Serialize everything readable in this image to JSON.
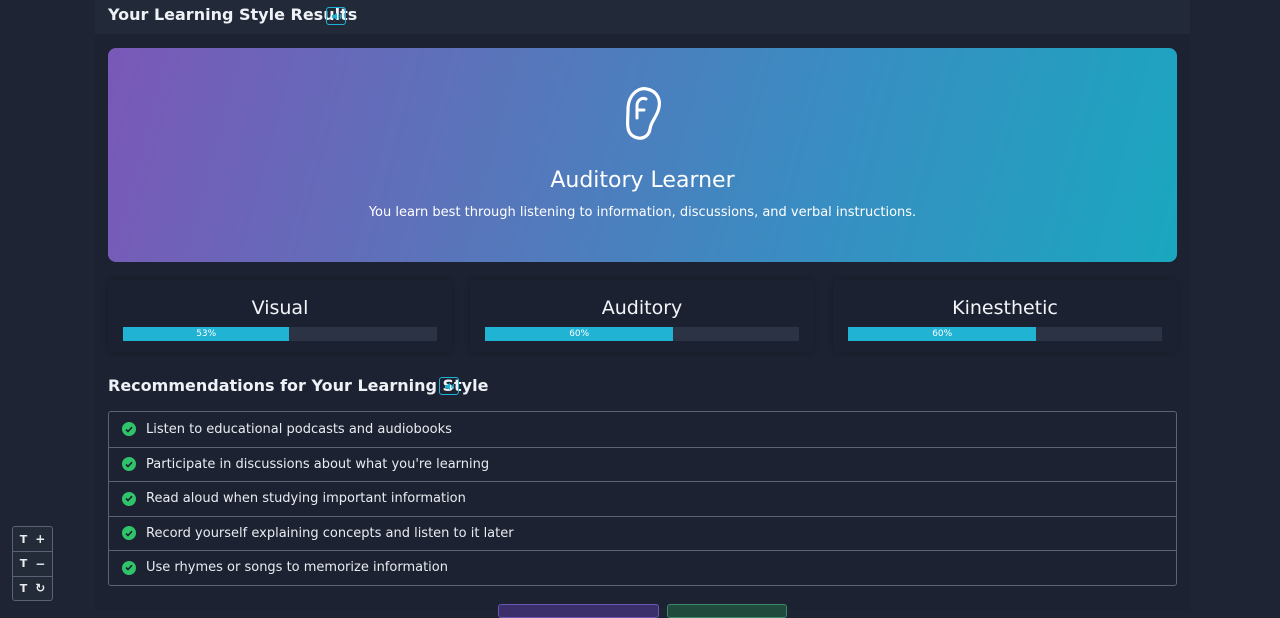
{
  "results": {
    "title": "Your Learning Style Results"
  },
  "hero": {
    "icon": "ear-icon",
    "title": "Auditory Learner",
    "description": "You learn best through listening to information, discussions, and verbal instructions."
  },
  "scores": [
    {
      "label": "Visual",
      "value": 53,
      "text": "53%"
    },
    {
      "label": "Auditory",
      "value": 60,
      "text": "60%"
    },
    {
      "label": "Kinesthetic",
      "value": 60,
      "text": "60%"
    }
  ],
  "recommendations": {
    "title": "Recommendations for Your Learning Style",
    "items": [
      "Listen to educational podcasts and audiobooks",
      "Participate in discussions about what you're learning",
      "Read aloud when studying important information",
      "Record yourself explaining concepts and listen to it later",
      "Use rhymes or songs to memorize information"
    ]
  },
  "font_tools": {
    "increase": {
      "letter": "T",
      "symbol": "+"
    },
    "decrease": {
      "letter": "T",
      "symbol": "−"
    },
    "reset": {
      "letter": "T",
      "symbol": "↻"
    }
  },
  "colors": {
    "accent": "#21b3d4",
    "check": "#2fc46a",
    "background": "#1c2231"
  }
}
